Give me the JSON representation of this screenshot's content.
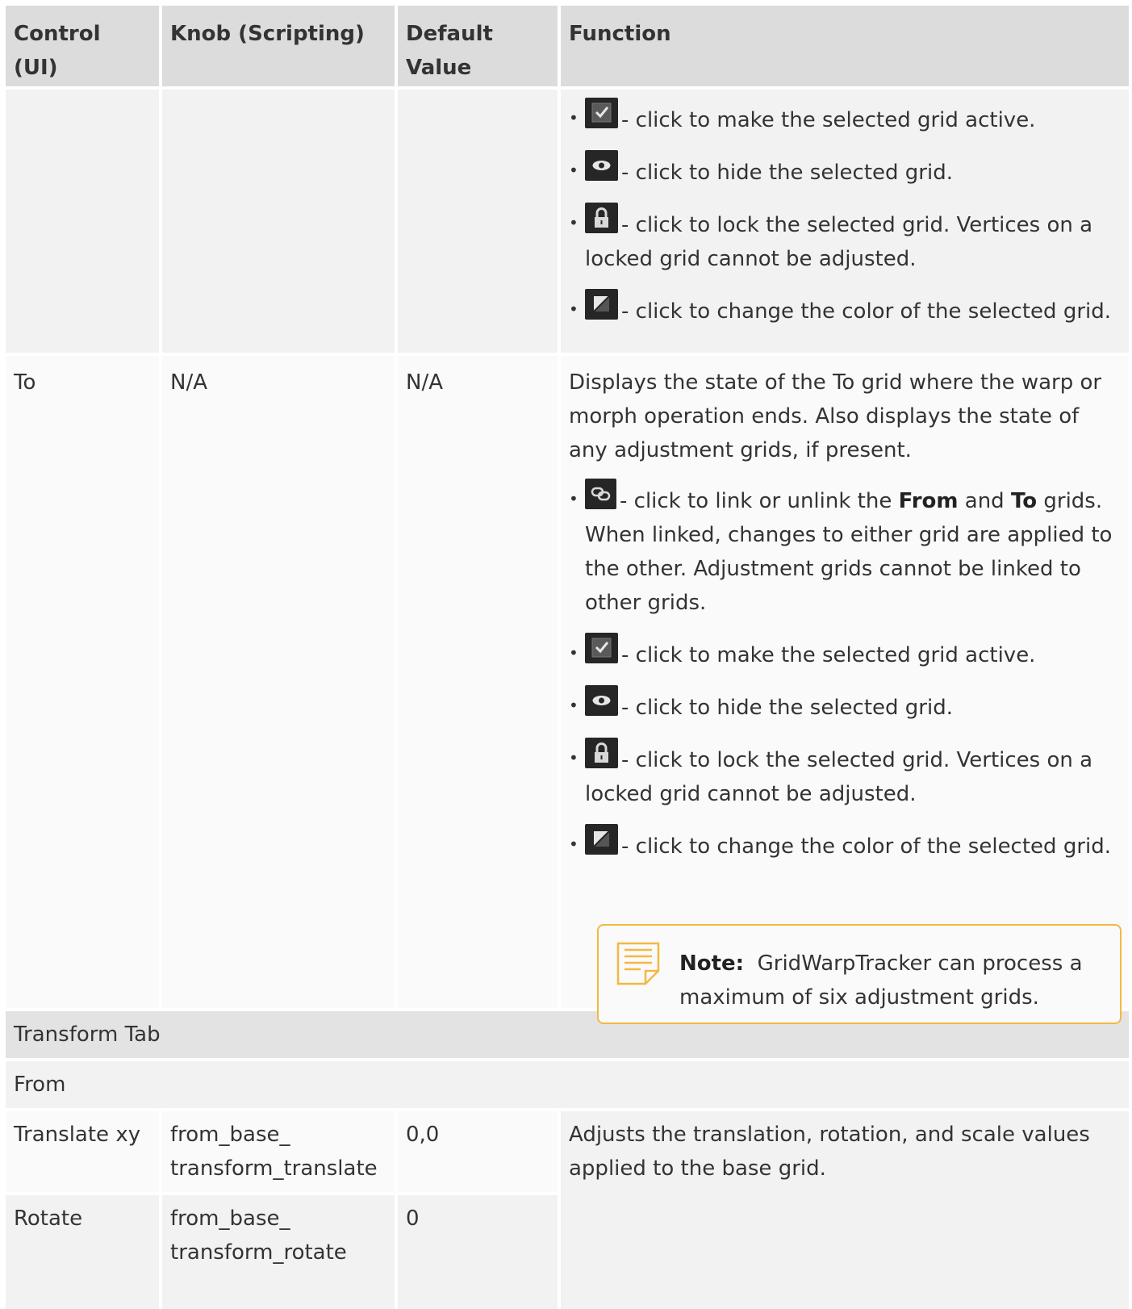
{
  "headers": {
    "control": "Control (UI)",
    "knob": "Knob (Scripting)",
    "default": "Default Value",
    "function": "Function"
  },
  "row_from_icons": {
    "items": [
      "- click to make the selected grid active.",
      "- click to hide the selected grid.",
      "- click to lock the selected grid. Vertices on a locked grid cannot be adjusted.",
      "- click to change the color of the selected grid."
    ]
  },
  "row_to": {
    "control": "To",
    "knob": "N/A",
    "default": "N/A",
    "description": "Displays the state of the To grid where the warp or morph operation ends. Also displays the state of any adjustment grids, if present.",
    "link_item": {
      "prefix": "- click to link or unlink the ",
      "bold1": "From",
      "middle": " and ",
      "bold2": "To",
      "suffix": " grids. When linked, changes to either grid are applied to the other. Adjustment grids cannot be linked to other grids."
    },
    "items": [
      "- click to make the selected grid active.",
      "- click to hide the selected grid.",
      "- click to lock the selected grid. Vertices on a locked grid cannot be adjusted.",
      "- click to change the color of the selected grid."
    ],
    "note": {
      "label": "Note:",
      "text": "GridWarpTracker can process a maximum of six adjustment grids."
    }
  },
  "section_transform": "Transform Tab",
  "subsection_from": "From",
  "row_translate": {
    "control": "Translate xy",
    "knob": "from_base_ transform_translate",
    "default": "0,0",
    "function": "Adjusts the translation, rotation, and scale values applied to the base grid."
  },
  "row_rotate": {
    "control": "Rotate",
    "knob": "from_base_ transform_rotate",
    "default": "0"
  },
  "icons": [
    "checkbox-icon",
    "eye-icon",
    "lock-icon",
    "color-swatch-icon",
    "link-icon"
  ]
}
